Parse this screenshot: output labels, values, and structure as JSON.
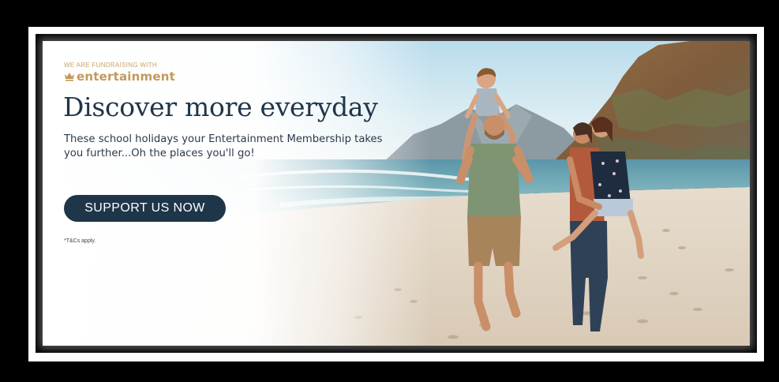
{
  "brand": {
    "tagline": "WE ARE FUNDRAISING WITH",
    "name": "entertainment",
    "color": "#c39a5c",
    "icon": "crown-icon"
  },
  "headline": "Discover more everyday",
  "subtext": "These school holidays your Entertainment Membership takes you further...Oh the places you'll go!",
  "cta": {
    "label": "SUPPORT US NOW",
    "color": "#1f3549"
  },
  "terms": "*T&Cs apply.",
  "photo": "family-on-beach-photo"
}
